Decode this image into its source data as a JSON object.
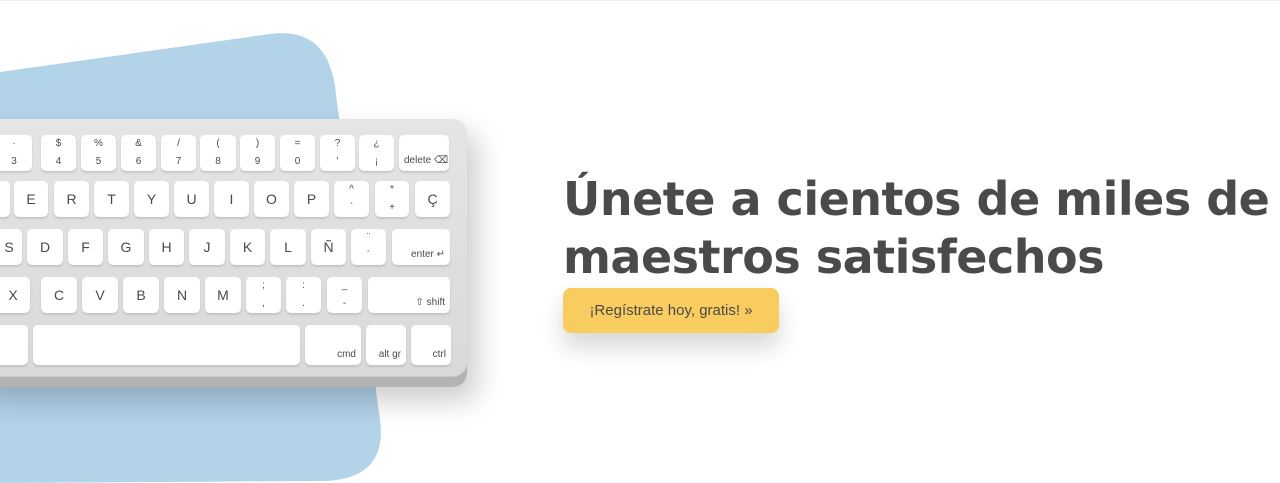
{
  "banner": {
    "headline_line1": "Únete a cientos de miles de",
    "headline_line2": "maestros satisfechos",
    "cta_label": "¡Regístrate hoy, gratis! »"
  },
  "colors": {
    "blob": "#b3d3e9",
    "cta": "#f8cc5f",
    "text": "#4a4a4a"
  },
  "keyboard": {
    "row1": [
      {
        "top": "·",
        "bottom": "3"
      },
      {
        "top": "$",
        "bottom": "4"
      },
      {
        "top": "%",
        "bottom": "5"
      },
      {
        "top": "&",
        "bottom": "6"
      },
      {
        "top": "/",
        "bottom": "7"
      },
      {
        "top": "(",
        "bottom": "8"
      },
      {
        "top": ")",
        "bottom": "9"
      },
      {
        "top": "=",
        "bottom": "0"
      },
      {
        "top": "?",
        "bottom": "'"
      },
      {
        "top": "¿",
        "bottom": "¡"
      },
      {
        "label": "delete ⌫"
      }
    ],
    "row2": [
      {
        "label": "E"
      },
      {
        "label": "R"
      },
      {
        "label": "T"
      },
      {
        "label": "Y"
      },
      {
        "label": "U"
      },
      {
        "label": "I"
      },
      {
        "label": "O"
      },
      {
        "label": "P"
      },
      {
        "top": "^",
        "bottom": "`"
      },
      {
        "top": "*",
        "bottom": "+"
      },
      {
        "label": "Ç"
      }
    ],
    "row3": [
      {
        "label": "S"
      },
      {
        "label": "D"
      },
      {
        "label": "F"
      },
      {
        "label": "G"
      },
      {
        "label": "H"
      },
      {
        "label": "J"
      },
      {
        "label": "K"
      },
      {
        "label": "L"
      },
      {
        "label": "Ñ"
      },
      {
        "top": "¨",
        "bottom": "´"
      },
      {
        "label": "enter ↵"
      }
    ],
    "row4": [
      {
        "label": "X"
      },
      {
        "label": "C"
      },
      {
        "label": "V"
      },
      {
        "label": "B"
      },
      {
        "label": "N"
      },
      {
        "label": "M"
      },
      {
        "top": ";",
        "bottom": ","
      },
      {
        "top": ":",
        "bottom": "."
      },
      {
        "top": "_",
        "bottom": "-"
      },
      {
        "label": "⇧ shift"
      }
    ],
    "row5": [
      {
        "label": ""
      },
      {
        "label": ""
      },
      {
        "label": "cmd"
      },
      {
        "label": "alt gr"
      },
      {
        "label": "ctrl"
      }
    ]
  }
}
